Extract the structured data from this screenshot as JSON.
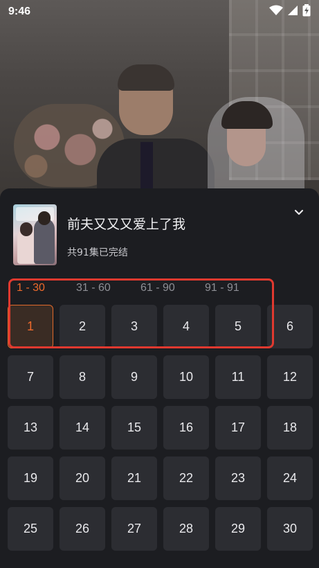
{
  "status_bar": {
    "time": "9:46"
  },
  "drama": {
    "title": "前夫又又又爱上了我",
    "info": "共91集已完结"
  },
  "range_tabs": [
    {
      "label": "1 - 30",
      "active": true
    },
    {
      "label": "31 - 60",
      "active": false
    },
    {
      "label": "61 - 90",
      "active": false
    },
    {
      "label": "91 - 91",
      "active": false
    }
  ],
  "episodes": [
    "1",
    "2",
    "3",
    "4",
    "5",
    "6",
    "7",
    "8",
    "9",
    "10",
    "11",
    "12",
    "13",
    "14",
    "15",
    "16",
    "17",
    "18",
    "19",
    "20",
    "21",
    "22",
    "23",
    "24",
    "25",
    "26",
    "27",
    "28",
    "29",
    "30"
  ],
  "selected_episode": "1",
  "icons": {
    "collapse": "chevron-down-icon",
    "wifi": "wifi-icon",
    "signal": "signal-icon",
    "battery": "battery-charging-icon"
  },
  "colors": {
    "accent": "#ee6a2c",
    "highlight": "#e0392f",
    "sheet_bg": "#1c1d21",
    "tile_bg": "#2c2d32"
  }
}
